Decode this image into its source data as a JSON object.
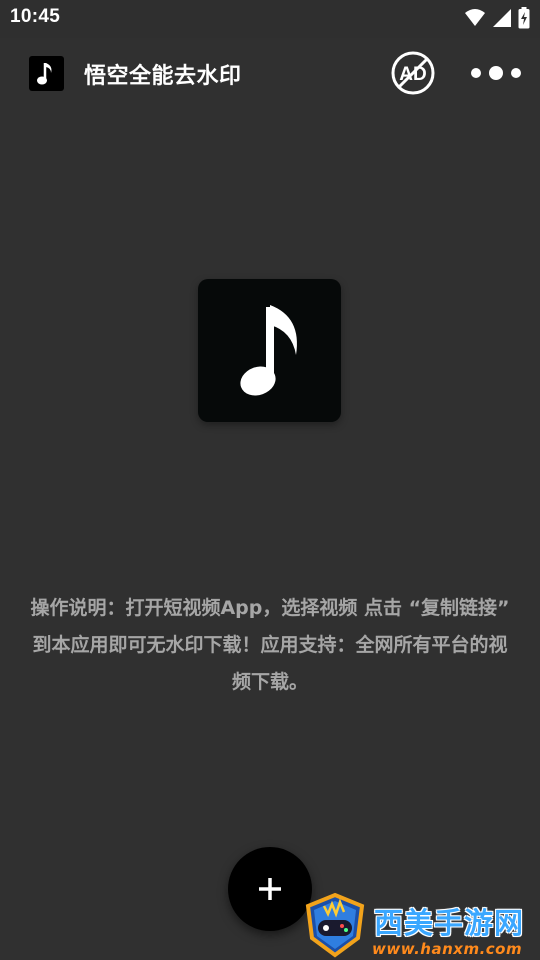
{
  "status_bar": {
    "time": "10:45",
    "icons": [
      "wifi-icon",
      "signal-icon",
      "battery-charging-icon"
    ]
  },
  "app_bar": {
    "logo_icon": "music-note-icon",
    "title": "悟空全能去水印",
    "ad_button_icon": "no-ads-icon",
    "ad_button_text": "AD",
    "more_button_icon": "more-dots-icon"
  },
  "main": {
    "logo_icon": "music-note-icon",
    "instructions": "操作说明：打开短视频App，选择视频 点击 “复制链接” 到本应用即可无水印下载！应用支持：全网所有平台的视频下载。"
  },
  "fab": {
    "icon": "plus-icon"
  },
  "watermark": {
    "title": "西美手游网",
    "url": "www.hanxm.com",
    "badge_icon": "gamepad-shield-icon"
  },
  "colors": {
    "background": "#303030",
    "text_muted": "#a6a6a6",
    "logo_bg": "#060909",
    "fab_bg": "#000000",
    "watermark_blue": "#3aa7ff",
    "watermark_orange": "#ff8a1c"
  }
}
